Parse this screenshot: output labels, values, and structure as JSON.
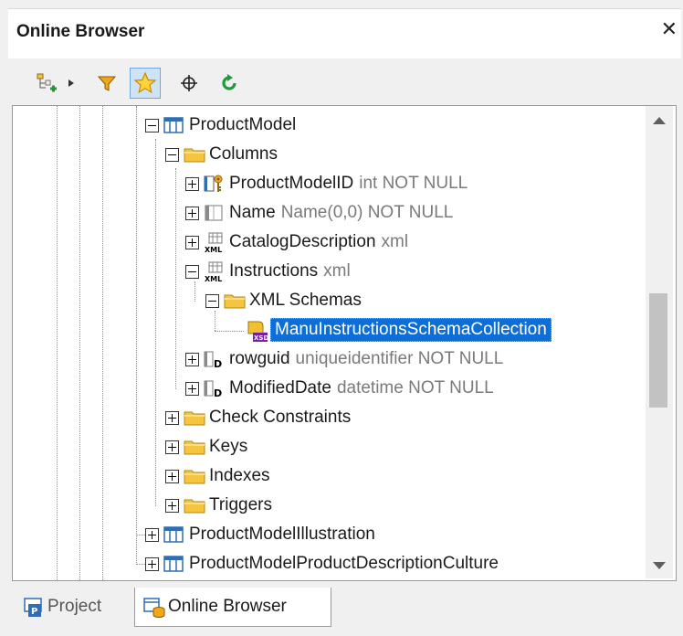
{
  "panel": {
    "title": "Online Browser",
    "close_label": "✕"
  },
  "toolbar": {
    "items": [
      {
        "name": "add-object-icon"
      },
      {
        "name": "dropdown-arrow-icon"
      },
      {
        "name": "filter-icon"
      },
      {
        "name": "favorites-star-icon",
        "active": true
      },
      {
        "name": "locate-crosshair-icon"
      },
      {
        "name": "refresh-icon"
      }
    ]
  },
  "tree": {
    "nodes": [
      {
        "label": "ProductModel",
        "detail": "",
        "icon": "table-icon",
        "expander": "minus"
      },
      {
        "label": "Columns",
        "detail": "",
        "icon": "folder-icon",
        "expander": "minus"
      },
      {
        "label": "ProductModelID",
        "detail": "int NOT NULL",
        "icon": "primary-key-column-icon",
        "expander": "plus"
      },
      {
        "label": "Name",
        "detail": "Name(0,0) NOT NULL",
        "icon": "column-icon",
        "expander": "plus"
      },
      {
        "label": "CatalogDescription",
        "detail": "xml",
        "icon": "xml-column-icon",
        "expander": "plus"
      },
      {
        "label": "Instructions",
        "detail": "xml",
        "icon": "xml-column-icon",
        "expander": "minus"
      },
      {
        "label": "XML Schemas",
        "detail": "",
        "icon": "folder-icon",
        "expander": "minus"
      },
      {
        "label": "ManuInstructionsSchemaCollection",
        "detail": "",
        "icon": "xsd-schema-icon",
        "expander": "none",
        "selected": true
      },
      {
        "label": "rowguid",
        "detail": "uniqueidentifier NOT NULL",
        "icon": "default-column-icon",
        "expander": "plus"
      },
      {
        "label": "ModifiedDate",
        "detail": "datetime NOT NULL",
        "icon": "default-column-icon",
        "expander": "plus"
      },
      {
        "label": "Check Constraints",
        "detail": "",
        "icon": "folder-icon",
        "expander": "plus"
      },
      {
        "label": "Keys",
        "detail": "",
        "icon": "folder-icon",
        "expander": "plus"
      },
      {
        "label": "Indexes",
        "detail": "",
        "icon": "folder-icon",
        "expander": "plus"
      },
      {
        "label": "Triggers",
        "detail": "",
        "icon": "folder-icon",
        "expander": "plus"
      },
      {
        "label": "ProductModelIllustration",
        "detail": "",
        "icon": "table-icon",
        "expander": "plus"
      },
      {
        "label": "ProductModelProductDescriptionCulture",
        "detail": "",
        "icon": "table-icon",
        "expander": "plus"
      }
    ]
  },
  "tabs": [
    {
      "label": "Project",
      "icon": "project-icon",
      "active": false
    },
    {
      "label": "Online Browser",
      "icon": "online-browser-icon",
      "active": true
    }
  ],
  "colors": {
    "selection": "#0d6fd6",
    "folder": "#f5c542",
    "table": "#2f6db5",
    "refresh": "#1e9b3a"
  }
}
